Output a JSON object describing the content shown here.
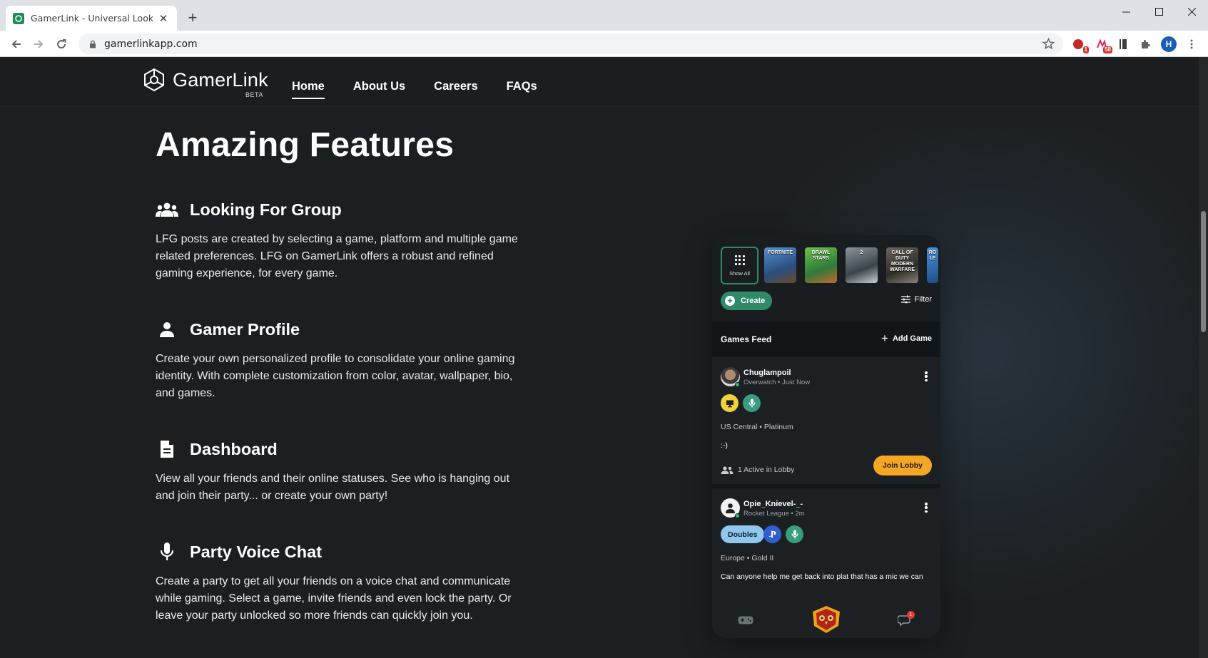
{
  "browser": {
    "tab_title": "GamerLink - Universal Looking F",
    "tab_close": "✕",
    "new_tab": "+",
    "url": "gamerlinkapp.com",
    "profile_initial": "H",
    "extensions": [
      {
        "name": "extension-1",
        "badge": "1"
      },
      {
        "name": "extension-2",
        "badge": "58"
      }
    ]
  },
  "site": {
    "logo_text": "GamerLink",
    "logo_sub": "BETA",
    "nav": [
      {
        "label": "Home",
        "active": true
      },
      {
        "label": "About Us",
        "active": false
      },
      {
        "label": "Careers",
        "active": false
      },
      {
        "label": "FAQs",
        "active": false
      }
    ]
  },
  "features": {
    "title": "Amazing Features",
    "items": [
      {
        "icon": "group-icon",
        "title": "Looking For Group",
        "description": "LFG posts are created by selecting a game, platform and multiple game related preferences. LFG on GamerLink offers a robust and refined gaming experience, for every game."
      },
      {
        "icon": "person-icon",
        "title": "Gamer Profile",
        "description": "Create your own personalized profile to consolidate your online gaming identity. With complete customization from color, avatar, wallpaper, bio, and games."
      },
      {
        "icon": "document-icon",
        "title": "Dashboard",
        "description": "View all your friends and their online statuses. See who is hanging out and join their party... or create your own party!"
      },
      {
        "icon": "microphone-icon",
        "title": "Party Voice Chat",
        "description": "Create a party to get all your friends on a voice chat and communicate while gaming. Select a game, invite friends and even lock the party. Or leave your party unlocked so more friends can quickly join you."
      }
    ]
  },
  "app": {
    "show_all": "Show All",
    "games": [
      {
        "label": "FORTNITE",
        "color": "#3b6fb0"
      },
      {
        "label": "BRAWL STARS",
        "color": "#4a8c3a"
      },
      {
        "label": "2",
        "color": "#5b6770"
      },
      {
        "label": "CALL OF DUTY MODERN WARFARE",
        "color": "#4e4a44"
      },
      {
        "label": "RO LE",
        "color": "#2d6ea8"
      }
    ],
    "create_label": "Create",
    "filter_label": "Filter",
    "feed_title": "Games Feed",
    "add_game_label": "Add Game",
    "posts": [
      {
        "name": "Chuglampoil",
        "sub": "Overwatch • Just Now",
        "region": "US Central • Platinum",
        "message": ":-)",
        "lobby": "1 Active in Lobby",
        "join": "Join Lobby"
      },
      {
        "name": "Opie_Knievel-_-",
        "sub": "Rocket League • 2m",
        "tag": "Doubles",
        "region": "Europe • Gold II",
        "message": "Can anyone help me get back into plat that has a mic we can"
      }
    ],
    "notification_count": "1"
  },
  "colors": {
    "accent_green": "#2f8b67",
    "join_orange": "#f5a623",
    "page_bg": "#1b1f21"
  }
}
